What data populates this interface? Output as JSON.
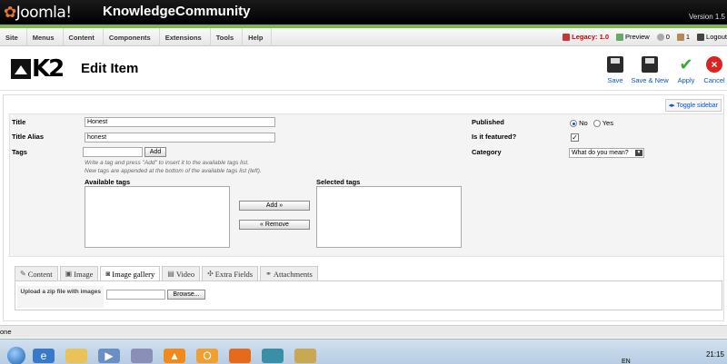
{
  "app": {
    "logo": "Joomla!",
    "site_name": "KnowledgeCommunity",
    "version": "Version 1.5"
  },
  "menu": {
    "items": [
      "Site",
      "Menus",
      "Content",
      "Components",
      "Extensions",
      "Tools",
      "Help"
    ]
  },
  "status": {
    "legacy": "Legacy: 1.0",
    "preview": "Preview",
    "messages": "0",
    "users": "1",
    "logout": "Logout"
  },
  "page": {
    "title": "Edit Item"
  },
  "toolbar": {
    "save": "Save",
    "save_new": "Save & New",
    "apply": "Apply",
    "cancel": "Cancel"
  },
  "toggle_sidebar": "Toggle sidebar",
  "form": {
    "title_label": "Title",
    "title_value": "Honest",
    "alias_label": "Title Alias",
    "alias_value": "honest",
    "tags_label": "Tags",
    "tags_value": "",
    "add_label": "Add",
    "tags_help_1": "Write a tag and press \"Add\" to insert it to the available tags list.",
    "tags_help_2": "New tags are appended at the bottom of the available tags list (left).",
    "available_tags_label": "Available tags",
    "selected_tags_label": "Selected tags",
    "add_tag_button": "Add »",
    "remove_tag_button": "« Remove",
    "published_label": "Published",
    "published_no": "No",
    "published_yes": "Yes",
    "published_value": "No",
    "featured_label": "Is it featured?",
    "featured_checked": true,
    "category_label": "Category",
    "category_value": "What do you mean?"
  },
  "tabs": [
    {
      "label": "Content",
      "icon": "pencil-icon"
    },
    {
      "label": "Image",
      "icon": "image-icon"
    },
    {
      "label": "Image gallery",
      "icon": "gallery-icon",
      "active": true
    },
    {
      "label": "Video",
      "icon": "video-icon"
    },
    {
      "label": "Extra Fields",
      "icon": "fields-icon"
    },
    {
      "label": "Attachments",
      "icon": "attachment-icon"
    }
  ],
  "gallery": {
    "upload_label": "Upload a zip file with images",
    "browse": "Browse..."
  },
  "browser_status": "one",
  "taskbar": {
    "lang": "EN",
    "clock": "21:15"
  },
  "colors": {
    "accent_green": "#7bb84a",
    "link_blue": "#0b55c4",
    "legacy_red": "#cc0000"
  }
}
